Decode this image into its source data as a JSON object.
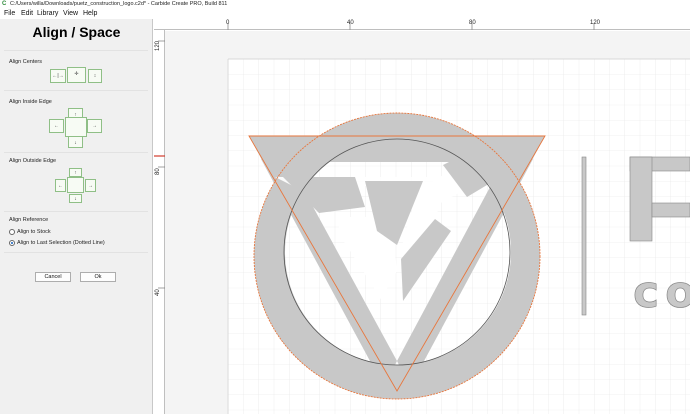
{
  "window": {
    "title": "C:/Users/willa/Downloads/puetz_construction_logo.c2d* - Carbide Create PRO, Build 811",
    "icon": "carbide-create-icon"
  },
  "menu": [
    {
      "label": "File"
    },
    {
      "label": "Edit"
    },
    {
      "label": "Library"
    },
    {
      "label": "View"
    },
    {
      "label": "Help"
    }
  ],
  "panel": {
    "title": "Align / Space",
    "align_centers_label": "Align Centers",
    "align_inside_label": "Align Inside Edge",
    "align_outside_label": "Align Outside Edge",
    "align_reference_label": "Align Reference",
    "reference_options": [
      {
        "label": "Align to Stock",
        "checked": false
      },
      {
        "label": "Align to Last Selection (Dotted Line)",
        "checked": true
      }
    ],
    "cancel_label": "Cancel",
    "ok_label": "Ok",
    "button_border_color": "#8fbf86"
  },
  "rulers": {
    "top_labels": [
      "0",
      "40",
      "80",
      "120"
    ],
    "left_labels": [
      "120",
      "80",
      "40"
    ]
  },
  "canvas": {
    "selection_color": "#e8763c",
    "shape_fill": "#c8c8c8",
    "circle_stroke": "#555555",
    "slash_icon": "vertical-bar",
    "letters_fragment": "co"
  }
}
